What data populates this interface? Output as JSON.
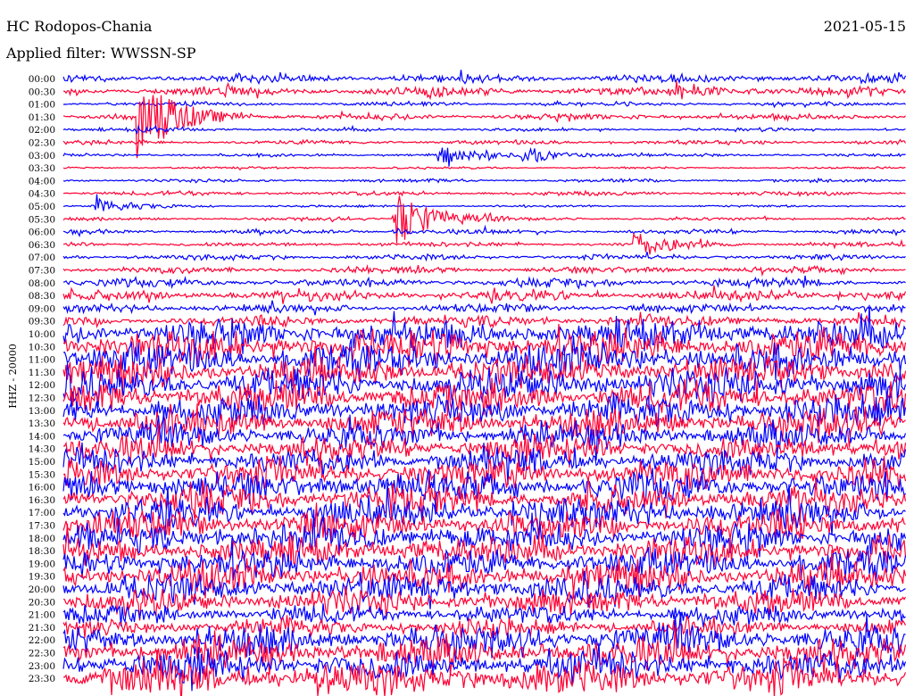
{
  "header": {
    "station": "HC Rodopos-Chania",
    "date": "2021-05-15",
    "filter": "Applied filter: WWSSN-SP"
  },
  "chart_data": {
    "type": "line",
    "title": "HC Rodopos-Chania",
    "ylabel": "HHZ - 20000",
    "xlabel": "",
    "minutes_per_line": 30,
    "colors": [
      "#0000ff",
      "#ff0033"
    ],
    "rows": [
      "00:00",
      "00:30",
      "01:00",
      "01:30",
      "02:00",
      "02:30",
      "03:00",
      "03:30",
      "04:00",
      "04:30",
      "05:00",
      "05:30",
      "06:00",
      "06:30",
      "07:00",
      "07:30",
      "08:00",
      "08:30",
      "09:00",
      "09:30",
      "10:00",
      "10:30",
      "11:00",
      "11:30",
      "12:00",
      "12:30",
      "13:00",
      "13:30",
      "14:00",
      "14:30",
      "15:00",
      "15:30",
      "16:00",
      "16:30",
      "17:00",
      "17:30",
      "18:00",
      "18:30",
      "19:00",
      "19:30",
      "20:00",
      "20:30",
      "21:00",
      "21:30",
      "22:00",
      "22:30",
      "23:00",
      "23:30"
    ],
    "noise_level": [
      4,
      4,
      2,
      3,
      1.5,
      2,
      1.5,
      1,
      1.5,
      2,
      1,
      1.5,
      2,
      2,
      2.5,
      3,
      4,
      5,
      4,
      5,
      14,
      16,
      16,
      14,
      16,
      15,
      14,
      14,
      12,
      12,
      12,
      14,
      14,
      14,
      14,
      14,
      14,
      14,
      14,
      14,
      13,
      12,
      9,
      8,
      14,
      14,
      14,
      16
    ],
    "events": [
      {
        "row": 3,
        "minute": 2.8,
        "amplitude": 40,
        "decay_rows": 7
      },
      {
        "row": 11,
        "minute": 11.9,
        "amplitude": 30,
        "decay_rows": 3
      },
      {
        "row": 6,
        "minute": 13.5,
        "amplitude": 8,
        "decay_rows": 0
      },
      {
        "row": 6,
        "minute": 16.5,
        "amplitude": 8,
        "decay_rows": 0
      },
      {
        "row": 10,
        "minute": 1.3,
        "amplitude": 7,
        "decay_rows": 0
      },
      {
        "row": 13,
        "minute": 20.5,
        "amplitude": 12,
        "decay_rows": 0
      },
      {
        "row": 1,
        "minute": 22,
        "amplitude": 8,
        "decay_rows": 0
      }
    ]
  }
}
